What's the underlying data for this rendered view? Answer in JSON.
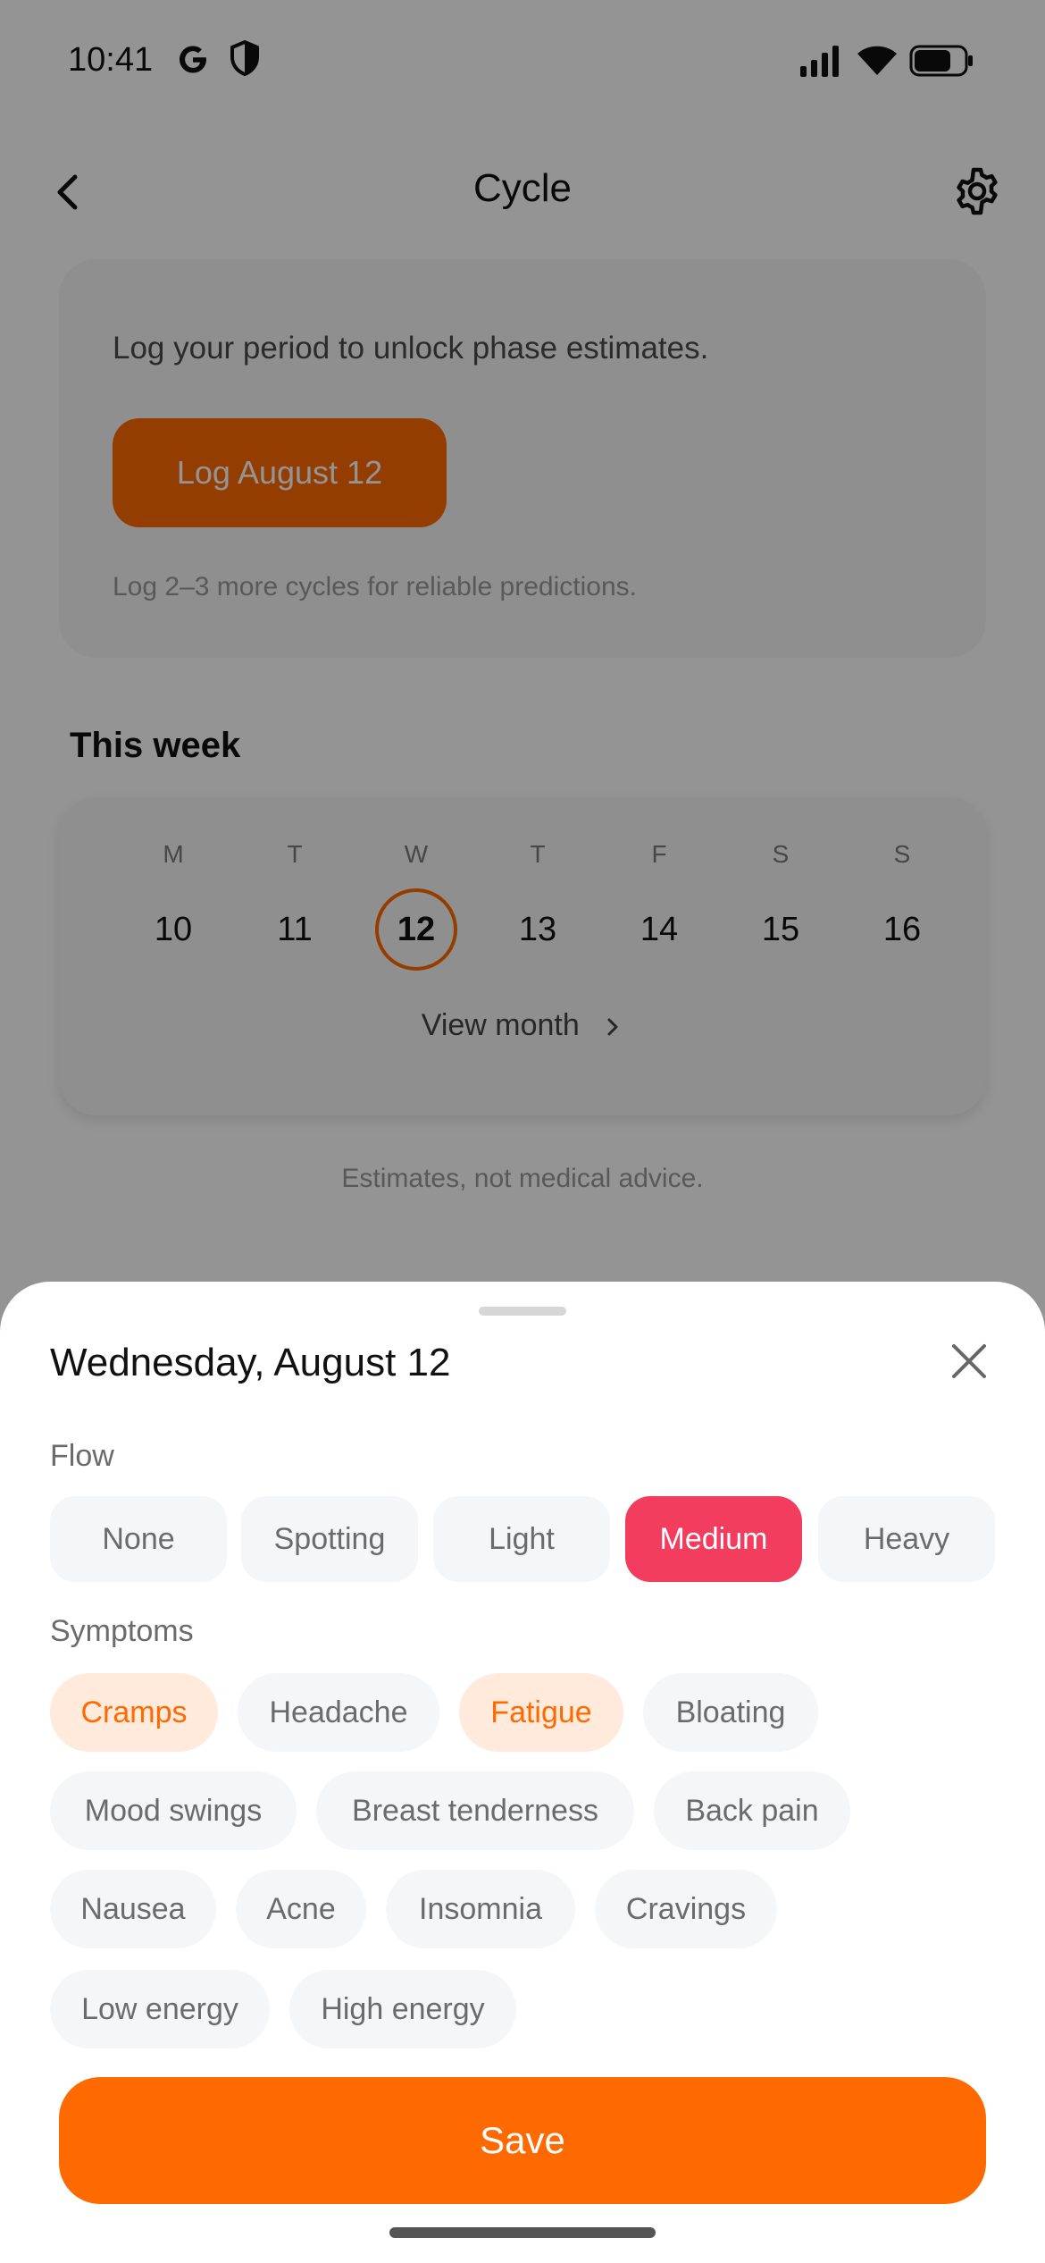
{
  "status_bar": {
    "time": "10:41",
    "icons": [
      "google-icon",
      "shield-icon",
      "signal-icon",
      "wifi-icon",
      "battery-icon"
    ]
  },
  "nav": {
    "title": "Cycle",
    "back_icon": "chevron-left-icon",
    "settings_icon": "gear-icon"
  },
  "phase_card": {
    "message": "Log your period to unlock phase estimates.",
    "log_button": "Log August 12",
    "note": "Log 2–3 more cycles for reliable predictions."
  },
  "week": {
    "title": "This week",
    "days": [
      {
        "letter": "M",
        "num": "10"
      },
      {
        "letter": "T",
        "num": "11"
      },
      {
        "letter": "W",
        "num": "12",
        "today": true
      },
      {
        "letter": "T",
        "num": "13"
      },
      {
        "letter": "F",
        "num": "14"
      },
      {
        "letter": "S",
        "num": "15"
      },
      {
        "letter": "S",
        "num": "16"
      }
    ],
    "view_month": "View month"
  },
  "disclaimer": "Estimates, not medical advice.",
  "sheet": {
    "title": "Wednesday, August 12",
    "flow_label": "Flow",
    "flow_options": [
      "None",
      "Spotting",
      "Light",
      "Medium",
      "Heavy"
    ],
    "flow_selected": "Medium",
    "symptoms_label": "Symptoms",
    "symptoms": [
      "Cramps",
      "Headache",
      "Fatigue",
      "Bloating",
      "Mood swings",
      "Breast tenderness",
      "Back pain",
      "Nausea",
      "Acne",
      "Insomnia",
      "Cravings",
      "Low energy",
      "High energy"
    ],
    "symptoms_selected": [
      "Cramps",
      "Fatigue"
    ],
    "save_label": "Save"
  },
  "colors": {
    "accent": "#ff6a00",
    "flow_selected": "#f23d5e",
    "symptom_selected_bg": "#ffeadb",
    "chip_bg": "#f5f6f8"
  }
}
